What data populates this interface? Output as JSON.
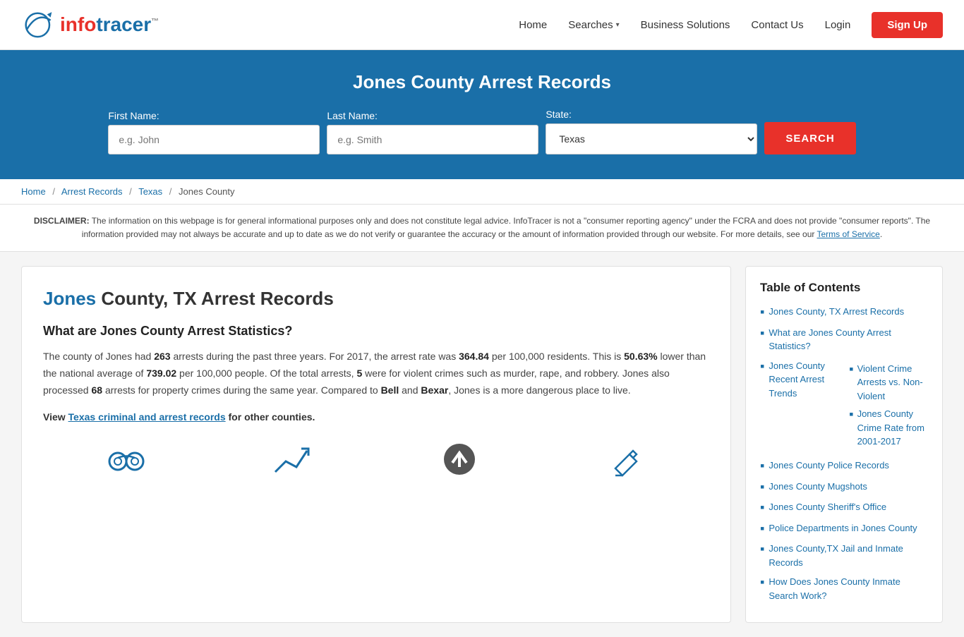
{
  "header": {
    "logo_info": "info",
    "logo_tracer": "tracer",
    "logo_tm": "™",
    "nav": {
      "home": "Home",
      "searches": "Searches",
      "business_solutions": "Business Solutions",
      "contact_us": "Contact Us",
      "login": "Login",
      "signup": "Sign Up"
    }
  },
  "hero": {
    "title": "Jones County Arrest Records",
    "first_name_label": "First Name:",
    "first_name_placeholder": "e.g. John",
    "last_name_label": "Last Name:",
    "last_name_placeholder": "e.g. Smith",
    "state_label": "State:",
    "state_value": "Texas",
    "search_btn": "SEARCH"
  },
  "breadcrumb": {
    "home": "Home",
    "arrest_records": "Arrest Records",
    "texas": "Texas",
    "jones_county": "Jones County"
  },
  "disclaimer": {
    "text": "The information on this webpage is for general informational purposes only and does not constitute legal advice. InfoTracer is not a \"consumer reporting agency\" under the FCRA and does not provide \"consumer reports\". The information provided may not always be accurate and up to date as we do not verify or guarantee the accuracy or the amount of information provided through our website. For more details, see our",
    "terms_link": "Terms of Service",
    "bold": "DISCLAIMER:"
  },
  "article": {
    "title_highlight": "Jones",
    "title_rest": " County, TX Arrest Records",
    "section1_heading": "What are Jones County Arrest Statistics?",
    "section1_p1_before": "The county of Jones had ",
    "section1_arrests": "263",
    "section1_p1_mid1": " arrests during the past three years. For 2017, the arrest rate was ",
    "section1_rate": "364.84",
    "section1_p1_mid2": " per 100,000 residents. This is ",
    "section1_lower": "50.63%",
    "section1_p1_mid3": " lower than the national average of ",
    "section1_national": "739.02",
    "section1_p1_mid4": " per 100,000 people. Of the total arrests, ",
    "section1_violent": "5",
    "section1_p1_mid5": " were for violent crimes such as murder, rape, and robbery. Jones also processed ",
    "section1_property": "68",
    "section1_p1_end": " arrests for property crimes during the same year. Compared to ",
    "section1_bell": "Bell",
    "section1_and": " and ",
    "section1_bexar": "Bexar",
    "section1_end": ", Jones is a more dangerous place to live.",
    "view_prefix": "View ",
    "view_link_text": "Texas criminal and arrest records",
    "view_suffix": " for other counties."
  },
  "toc": {
    "title": "Table of Contents",
    "items": [
      {
        "label": "Jones County, TX Arrest Records",
        "href": "#"
      },
      {
        "label": "What are Jones County Arrest Statistics?",
        "href": "#"
      },
      {
        "label": "Jones County Recent Arrest Trends",
        "href": "#",
        "children": [
          {
            "label": "Violent Crime Arrests vs. Non-Violent",
            "href": "#"
          },
          {
            "label": "Jones County Crime Rate from 2001-2017",
            "href": "#"
          }
        ]
      },
      {
        "label": "Jones County Police Records",
        "href": "#"
      },
      {
        "label": "Jones County Mugshots",
        "href": "#"
      },
      {
        "label": "Jones County Sheriff's Office",
        "href": "#"
      },
      {
        "label": "Police Departments in Jones County",
        "href": "#"
      },
      {
        "label": "Jones County,TX Jail and Inmate Records",
        "href": "#"
      },
      {
        "label": "How Does Jones County Inmate Search Work?",
        "href": "#"
      }
    ]
  }
}
